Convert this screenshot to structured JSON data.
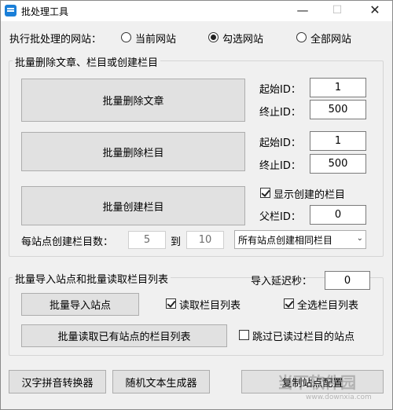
{
  "window": {
    "title": "批处理工具",
    "min": "—",
    "max": "☐",
    "close": "✕"
  },
  "scope": {
    "label": "执行批处理的网站：",
    "options": [
      {
        "label": "当前网站",
        "checked": false
      },
      {
        "label": "勾选网站",
        "checked": true
      },
      {
        "label": "全部网站",
        "checked": false
      }
    ]
  },
  "group1": {
    "title": "批量删除文章、栏目或创建栏目",
    "delete_articles": {
      "label": "批量删除文章",
      "start_label": "起始ID：",
      "start_value": "1",
      "end_label": "终止ID：",
      "end_value": "500"
    },
    "delete_columns": {
      "label": "批量删除栏目",
      "start_label": "起始ID：",
      "start_value": "1",
      "end_label": "终止ID：",
      "end_value": "500"
    },
    "create_columns": {
      "label": "批量创建栏目",
      "show_created_label": "显示创建的栏目",
      "show_created_checked": true,
      "parent_label": "父栏ID：",
      "parent_value": "0"
    },
    "per_site_label": "每站点创建栏目数：",
    "per_site_from": "5",
    "per_site_to_label": "到",
    "per_site_to": "10",
    "mode_select": "所有站点创建相同栏目"
  },
  "group2": {
    "title": "批量导入站点和批量读取栏目列表",
    "delay_label": "导入延迟秒：",
    "delay_value": "0",
    "import_sites": "批量导入站点",
    "read_columns_label": "读取栏目列表",
    "read_columns_checked": true,
    "select_all_label": "全选栏目列表",
    "select_all_checked": true,
    "read_existing": "批量读取已有站点的栏目列表",
    "skip_read_label": "跳过已读过栏目的站点",
    "skip_read_checked": false
  },
  "footer": {
    "pinyin": "汉字拼音转换器",
    "random_text": "随机文本生成器",
    "copy_config": "复制站点配置"
  },
  "watermark": {
    "text": "当下软件园",
    "url": "www.downxia.com"
  }
}
